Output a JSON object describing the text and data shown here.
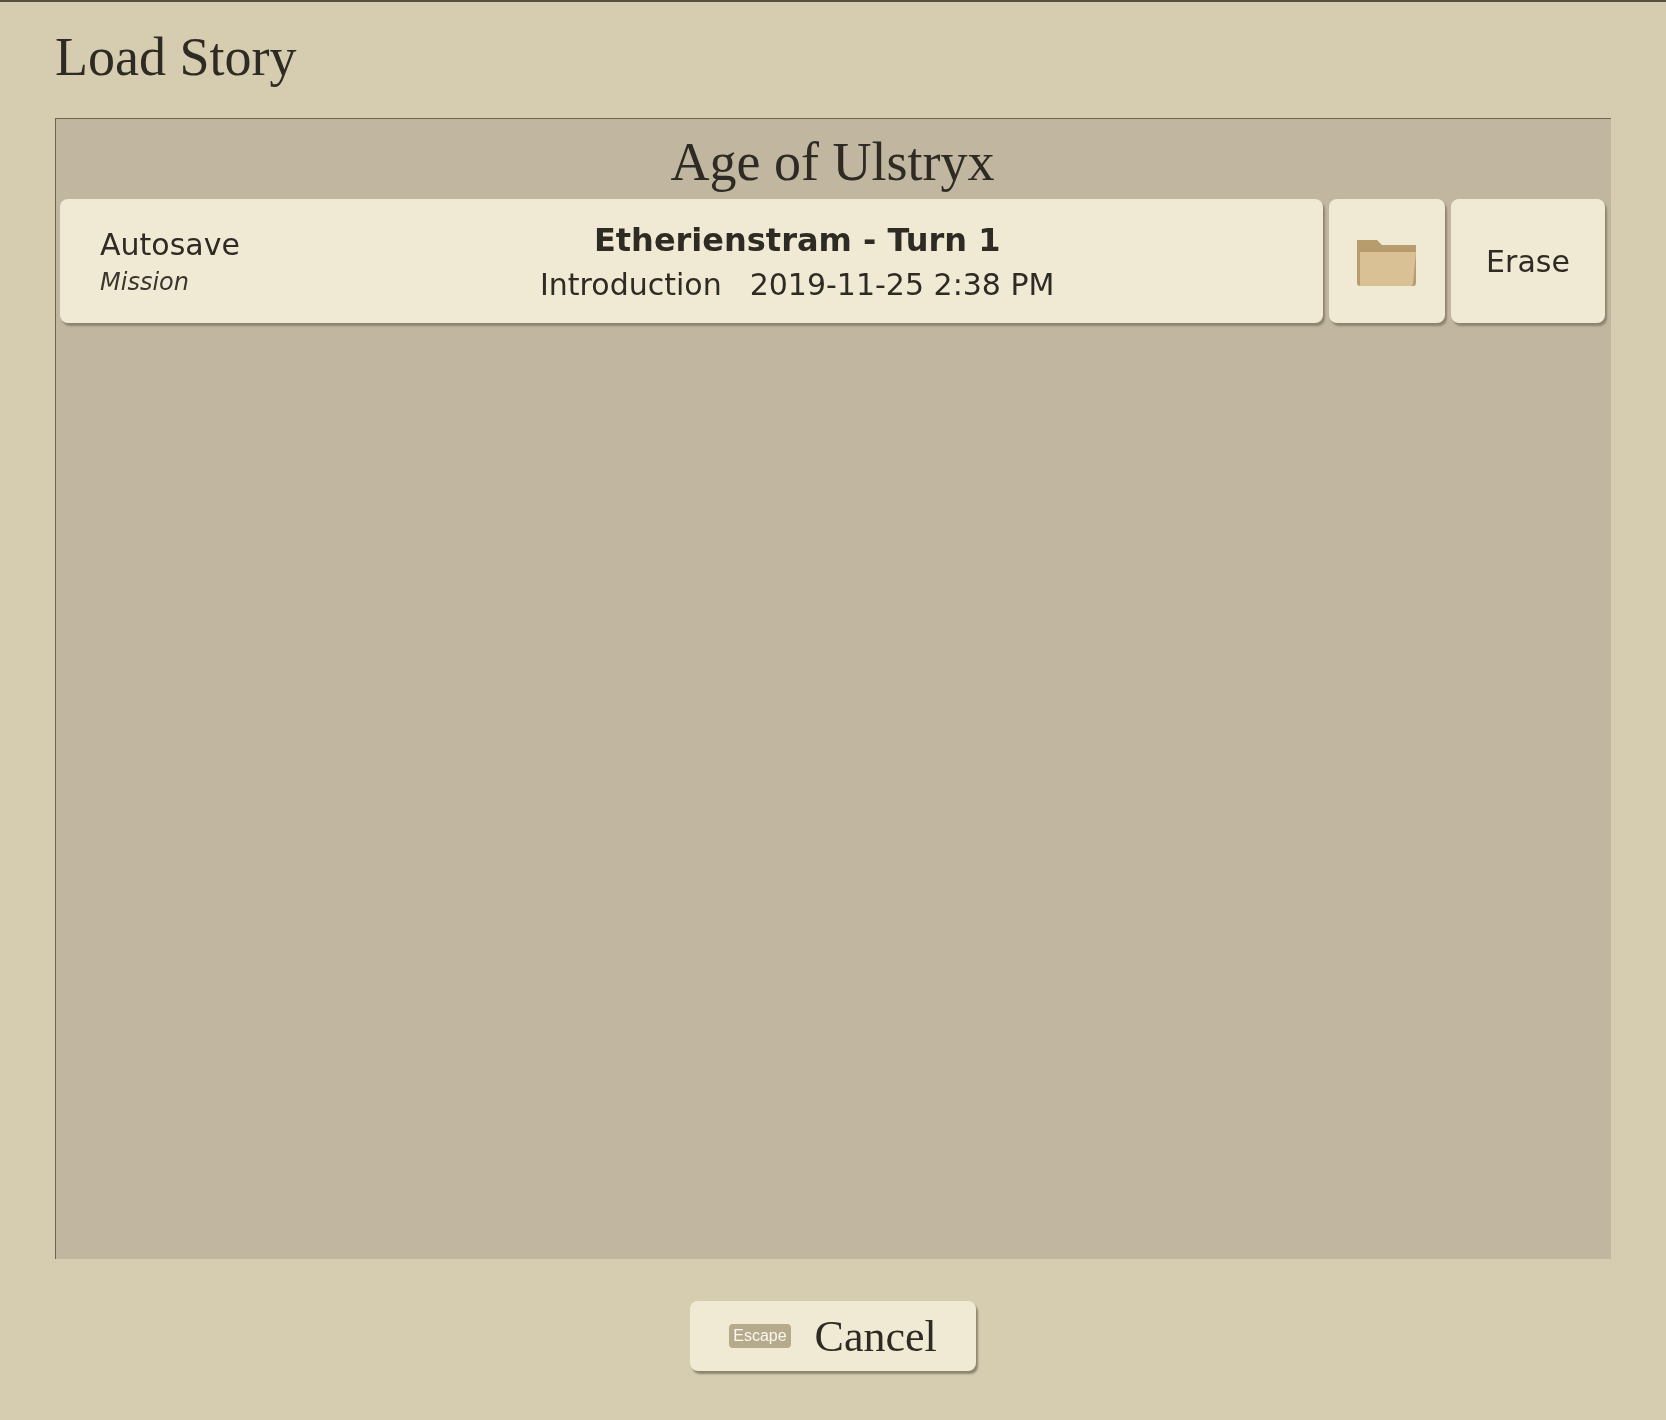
{
  "title": "Load Story",
  "story": {
    "name": "Age of Ulstryx",
    "saves": [
      {
        "slot": "Autosave",
        "type": "Mission",
        "name": "Etherienstram - Turn 1",
        "chapter": "Introduction",
        "date": "2019-11-25 2:38 PM",
        "erase": "Erase"
      }
    ]
  },
  "cancel": {
    "hotkey": "Escape",
    "label": "Cancel"
  }
}
